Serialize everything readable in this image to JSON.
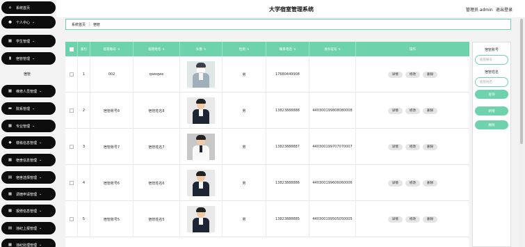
{
  "header": {
    "title": "大学宿室管理系统",
    "user": "管理员 admin",
    "logout": "退出登录"
  },
  "breadcrumb": {
    "home": "系统首页",
    "sep": "⋮",
    "current": "宿管"
  },
  "sidebar": {
    "items": [
      {
        "label": "系统首页",
        "icon": "home-icon",
        "glyph": "⌂",
        "chevron": false
      },
      {
        "label": "个人中心",
        "icon": "user-icon",
        "glyph": "●",
        "chevron": true
      },
      {
        "label": "学生管理",
        "icon": "grid-icon",
        "glyph": "▦",
        "chevron": true
      },
      {
        "label": "宿管管理",
        "icon": "bar-chart-icon",
        "glyph": "▮",
        "chevron": true
      },
      {
        "label": "维修人员管理",
        "icon": "grid-icon",
        "glyph": "▦",
        "chevron": true
      },
      {
        "label": "院系管理",
        "icon": "briefcase-icon",
        "glyph": "▬",
        "chevron": true
      },
      {
        "label": "专业管理",
        "icon": "grid-icon",
        "glyph": "▦",
        "chevron": true
      },
      {
        "label": "楼栋信息管理",
        "icon": "shield-icon",
        "glyph": "◆",
        "chevron": true
      },
      {
        "label": "宿舍信息管理",
        "icon": "grid-icon",
        "glyph": "▦",
        "chevron": true
      },
      {
        "label": "宿舍选择管理",
        "icon": "clipboard-icon",
        "glyph": "▤",
        "chevron": true
      },
      {
        "label": "调宿申请管理",
        "icon": "grid-icon",
        "glyph": "▦",
        "chevron": true
      },
      {
        "label": "报修信息管理",
        "icon": "grid-icon",
        "glyph": "▦",
        "chevron": true
      },
      {
        "label": "违纪上报管理",
        "icon": "file-icon",
        "glyph": "▤",
        "chevron": true
      },
      {
        "label": "违纪处理管理",
        "icon": "grid-icon",
        "glyph": "▦",
        "chevron": true
      }
    ],
    "submenu": "宿管"
  },
  "table": {
    "headers": [
      "索引",
      "宿管账号",
      "宿管姓名",
      "头像",
      "性别",
      "联系电话",
      "身份证号",
      "操作"
    ],
    "rows": [
      {
        "index": "1",
        "account": "002",
        "name": "qweqwe",
        "gender": "男",
        "phone": "17680449908",
        "idcard": "",
        "photo": "cartoon"
      },
      {
        "index": "2",
        "account": "宿管账号8",
        "name": "宿管姓名8",
        "gender": "男",
        "phone": "13823888888",
        "idcard": "440300199808080008",
        "photo": "suit"
      },
      {
        "index": "3",
        "account": "宿管账号7",
        "name": "宿管姓名7",
        "gender": "男",
        "phone": "13823888887",
        "idcard": "440300199707070007",
        "photo": "light"
      },
      {
        "index": "4",
        "account": "宿管账号6",
        "name": "宿管姓名6",
        "gender": "男",
        "phone": "13823888886",
        "idcard": "440300199606060006",
        "photo": "suit"
      },
      {
        "index": "5",
        "account": "宿管账号5",
        "name": "宿管姓名5",
        "gender": "男",
        "phone": "13823888885",
        "idcard": "440300199505050005",
        "photo": "suit"
      }
    ],
    "actions": {
      "detail": "详情",
      "edit": "修改",
      "delete": "删除"
    }
  },
  "search": {
    "account_label": "宿管账号",
    "account_placeholder": "宿管账号",
    "name_label": "宿管姓名",
    "name_placeholder": "宿管姓名",
    "search_btn": "查询",
    "add_btn": "新增",
    "delete_btn": "删除"
  },
  "colors": {
    "accent": "#6ed3ad",
    "sidebar": "#0d0d0d"
  }
}
